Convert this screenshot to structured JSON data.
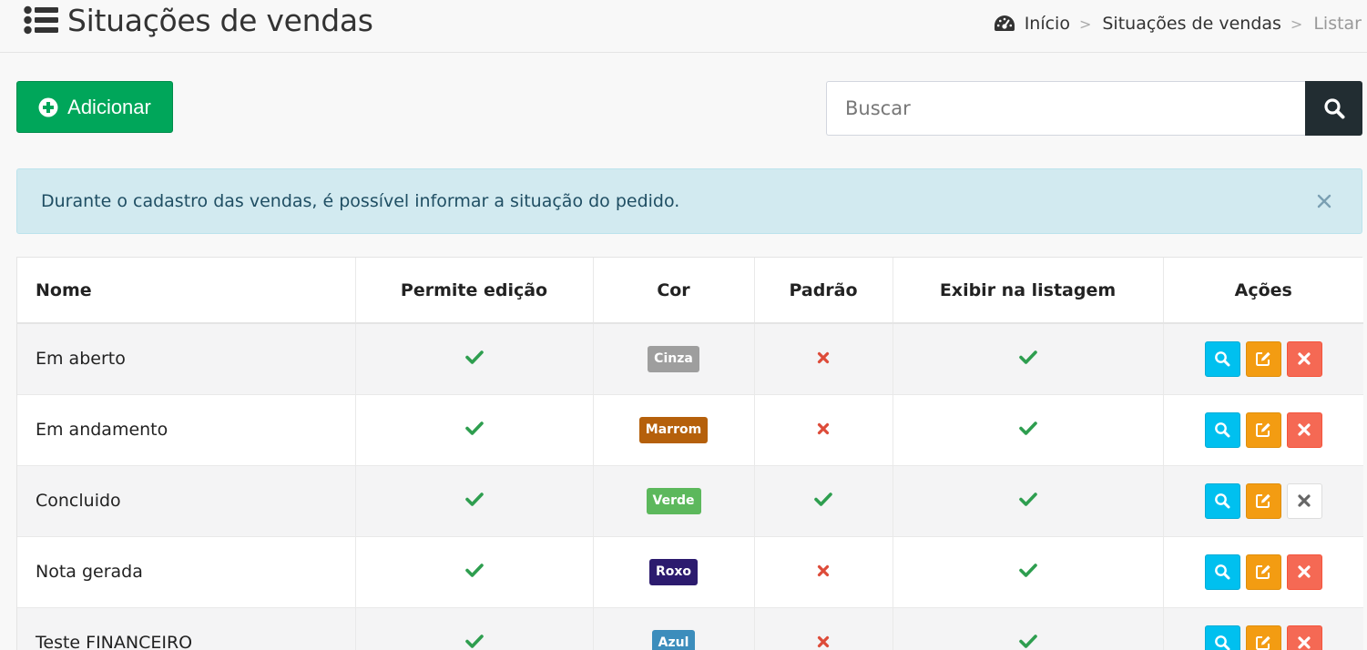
{
  "header": {
    "title": "Situações de vendas",
    "breadcrumb": [
      {
        "label": "Início"
      },
      {
        "label": "Situações de vendas"
      },
      {
        "label": "Listar"
      }
    ]
  },
  "toolbar": {
    "add_label": "Adicionar",
    "search_placeholder": "Buscar",
    "search_value": ""
  },
  "alert": {
    "text": "Durante o cadastro das vendas, é possível informar a situação do pedido."
  },
  "table": {
    "columns": [
      "Nome",
      "Permite edição",
      "Cor",
      "Padrão",
      "Exibir na listagem",
      "Ações"
    ],
    "rows": [
      {
        "nome": "Em aberto",
        "permite_edicao": true,
        "cor": "Cinza",
        "cor_hex": "#9e9e9e",
        "padrao": false,
        "exibir": true,
        "delete_enabled": true
      },
      {
        "nome": "Em andamento",
        "permite_edicao": true,
        "cor": "Marrom",
        "cor_hex": "#b5600b",
        "padrao": false,
        "exibir": true,
        "delete_enabled": true
      },
      {
        "nome": "Concluido",
        "permite_edicao": true,
        "cor": "Verde",
        "cor_hex": "#5cb85c",
        "padrao": true,
        "exibir": true,
        "delete_enabled": false
      },
      {
        "nome": "Nota gerada",
        "permite_edicao": true,
        "cor": "Roxo",
        "cor_hex": "#2c1b6e",
        "padrao": false,
        "exibir": true,
        "delete_enabled": true
      },
      {
        "nome": "Teste FINANCEIRO",
        "permite_edicao": true,
        "cor": "Azul",
        "cor_hex": "#3c8dbc",
        "padrao": false,
        "exibir": true,
        "delete_enabled": true
      }
    ]
  },
  "colors": {
    "add_button": "#00a65a",
    "search_button": "#222d32",
    "alert_bg": "#d2eaf0",
    "check": "#2e9e4f",
    "cross": "#dd4b39",
    "view_button": "#00c0ef",
    "edit_button": "#f39c12",
    "delete_button": "#f56954"
  },
  "icons": {
    "title": "list-icon",
    "breadcrumb_home": "dashboard-icon",
    "add": "plus-circle-icon",
    "search": "search-icon",
    "alert_close": "close-icon",
    "yes": "check-icon",
    "no": "cross-icon",
    "view": "search-icon",
    "edit": "edit-icon",
    "delete": "delete-icon"
  }
}
